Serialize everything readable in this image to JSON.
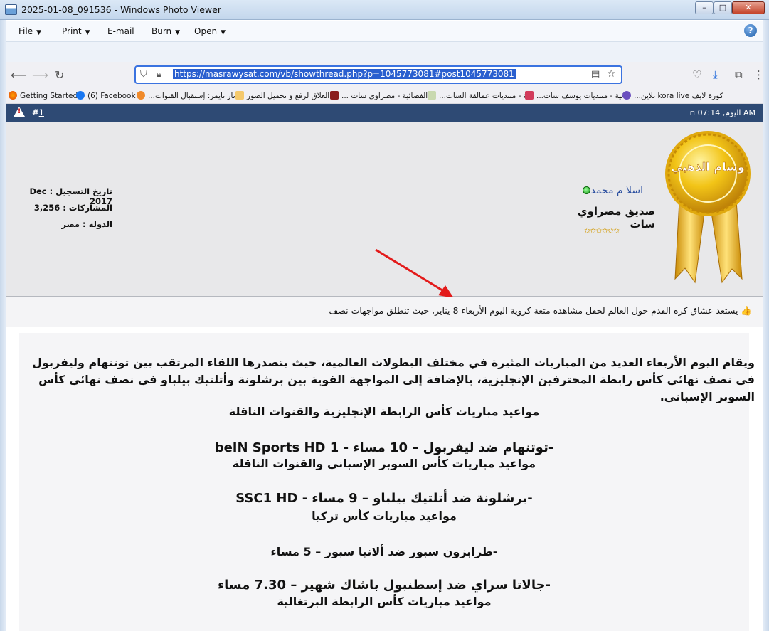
{
  "window": {
    "title": "2025-01-08_091536 - Windows Photo Viewer",
    "minimize": "–",
    "maximize": "□",
    "close": "✕"
  },
  "menubar": {
    "file": "File",
    "print": "Print",
    "email": "E-mail",
    "burn": "Burn",
    "open": "Open",
    "help": "?"
  },
  "browser": {
    "url": "https://masrawysat.com/vb/showthread.php?p=1045773081#post1045773081",
    "bookmarks": [
      "Getting Started",
      "(6) Facebook",
      "...تار تايمز: إستقبال القنوات",
      "العلاق لرفع و تحميل الصور",
      "... الفضائية - مصراوى سات",
      "...ية - منتديات عمالقة السات",
      "...ائية - منتديات يوسف سات",
      "kora live كورة لايف",
      "...نلاين"
    ]
  },
  "post": {
    "number_prefix": "#",
    "number": "1",
    "time": "اليوم, 07:14 AM"
  },
  "user": {
    "name": "اسلا م محمد",
    "title": "صديق مصراوي سات",
    "stars": "✩✩✩✩✩✩",
    "join_date": "تاريخ التسجيل : Dec 2017",
    "posts": "المشاركات : 3,256",
    "country": "الدولة : مصر",
    "medal_text": "وسام الذهبي"
  },
  "article": {
    "intro": "👍 يستعد عشاق كرة القدم حول العالم لحفل مشاهدة متعة كروية اليوم الأربعاء 8 يناير، حيث تنطلق مواجهات نصف",
    "paragraph": "ويقام اليوم الأربعاء العديد من المباريات المثيرة في مختلف البطولات العالمية، حيث يتصدرها اللقاء المرتقب بين توتنهام وليفربول في نصف نهائي كأس رابطة المحترفين الإنجليزية، بالإضافة إلى المواجهة القوية بين برشلونة وأتلتيك بيلباو في نصف نهائي كأس السوبر الإسباني.",
    "heading1": "مواعيد مباريات كأس الرابطة الإنجليزية والقنوات الناقلة",
    "match1": "-توتنهام ضد ليفربول – 10 مساء - beIN Sports HD 1",
    "heading2": "مواعيد مباريات كأس السوبر الإسباني والقنوات الناقلة",
    "match2": "-برشلونة ضد أتلتيك بيلباو – 9 مساء - SSC1 HD",
    "heading3": "مواعيد مباريات كأس تركيا",
    "match3": "-طرابزون سبور ضد ألانيا سبور – 5 مساء",
    "match4": "-جالاتا سراي ضد إسطنبول باشاك شهير – 7.30 مساء",
    "heading4": "مواعيد مباريات كأس الرابطة البرتغالية"
  }
}
